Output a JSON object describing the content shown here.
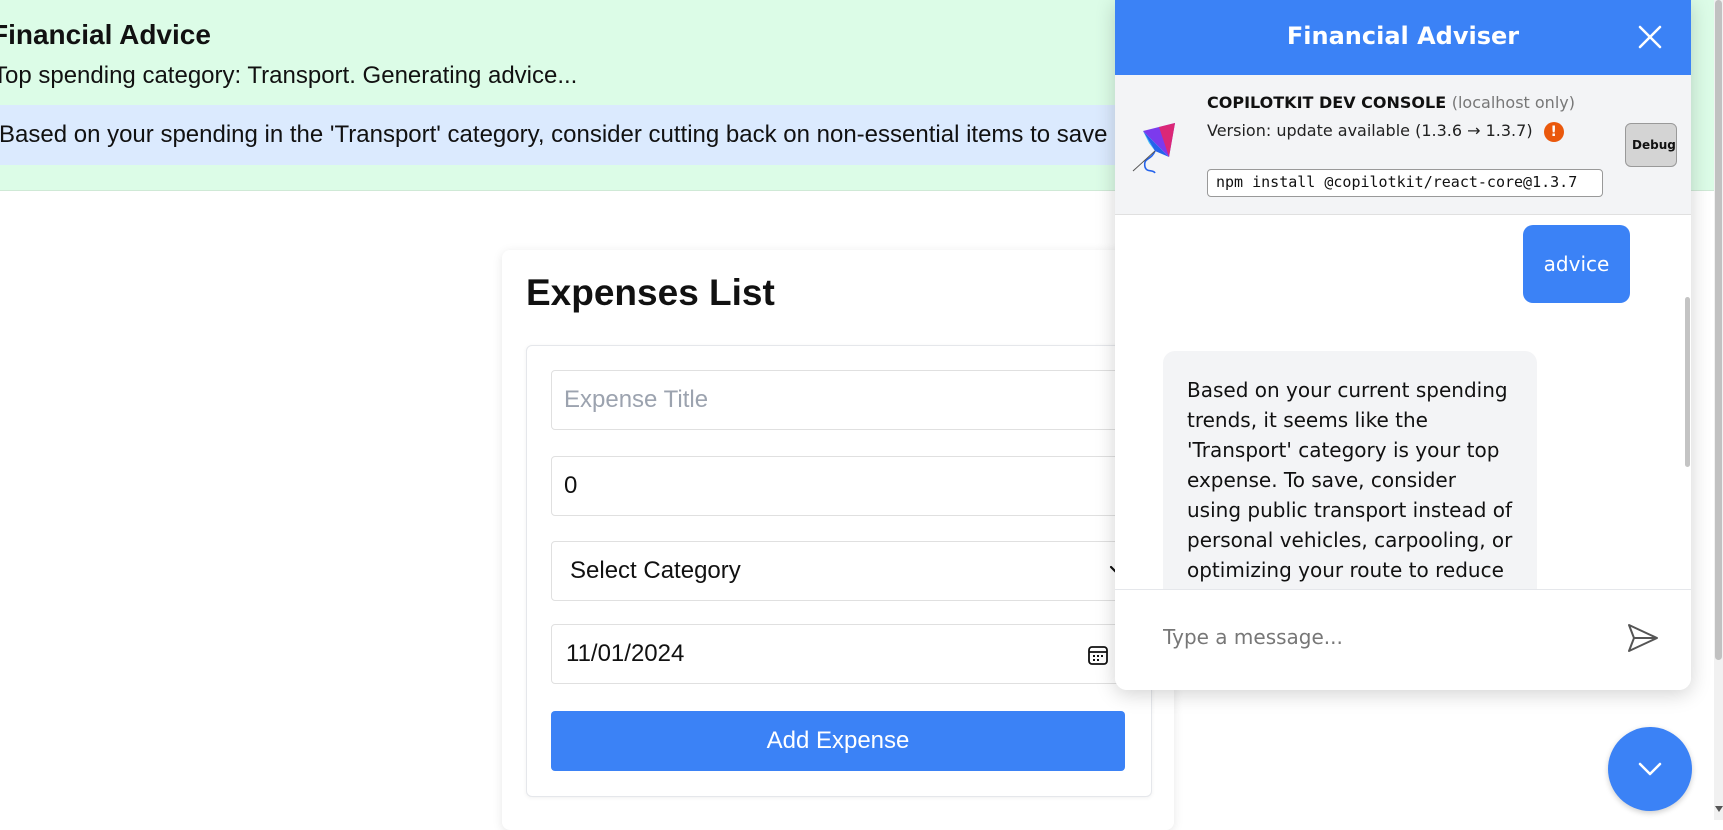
{
  "advice": {
    "title": "Financial Advice",
    "status": "Top spending category: Transport. Generating advice...",
    "text": "Based on your spending in the 'Transport' category, consider cutting back on non-essential items to save money."
  },
  "expenses": {
    "title": "Expenses List",
    "title_placeholder": "Expense Title",
    "amount_value": "0",
    "category_selected": "Select Category",
    "date_value": "11/01/2024",
    "add_label": "Add Expense"
  },
  "chat": {
    "title": "Financial Adviser",
    "console": {
      "title": "COPILOTKIT DEV CONSOLE",
      "scope": "(localhost only)",
      "version": "Version: update available (1.3.6 → 1.3.7)",
      "warn_glyph": "!",
      "command": "npm install @copilotkit/react-core@1.3.7",
      "debug_label": "Debug"
    },
    "messages": [
      {
        "role": "user",
        "text": "advice"
      },
      {
        "role": "assistant",
        "text": "Based on your current spending trends, it seems like the 'Transport' category is your top expense. To save, consider using public transport instead of personal vehicles, carpooling, or optimizing your route to reduce fuel"
      }
    ],
    "input_placeholder": "Type a message..."
  },
  "colors": {
    "accent": "#3b82f6",
    "banner_bg": "#dcfce7",
    "advice_box_bg": "#dbeafe",
    "warning": "#ea580c"
  },
  "icons": [
    "close-icon",
    "kite-logo-icon",
    "warning-icon",
    "send-icon",
    "chevron-down-icon",
    "calendar-icon"
  ]
}
